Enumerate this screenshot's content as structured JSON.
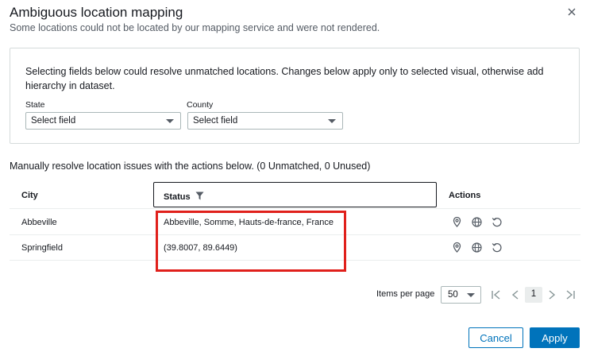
{
  "dialog": {
    "title": "Ambiguous location mapping",
    "subtitle": "Some locations could not be located by our mapping service and were not rendered.",
    "close_icon": "close-icon"
  },
  "panel": {
    "description": "Selecting fields below could resolve unmatched locations. Changes below apply only to selected visual, otherwise add hierarchy in dataset.",
    "fields": [
      {
        "label": "State",
        "value": "Select field"
      },
      {
        "label": "County",
        "value": "Select field"
      }
    ]
  },
  "manual_text": "Manually resolve location issues with the actions below. (0 Unmatched, 0 Unused)",
  "table": {
    "columns": [
      "City",
      "Status",
      "Actions"
    ],
    "rows": [
      {
        "city": "Abbeville",
        "status": "Abbeville, Somme, Hauts-de-france, France"
      },
      {
        "city": "Springfield",
        "status": "(39.8007, 89.6449)"
      }
    ],
    "action_icons": [
      "map-pin-icon",
      "globe-icon",
      "undo-icon"
    ]
  },
  "pagination": {
    "items_per_page_label": "Items per page",
    "items_per_page_value": "50",
    "current_page": "1"
  },
  "buttons": {
    "cancel": "Cancel",
    "apply": "Apply"
  },
  "colors": {
    "primary": "#0073bb",
    "highlight": "#e0201b",
    "border": "#d5dbdb"
  }
}
